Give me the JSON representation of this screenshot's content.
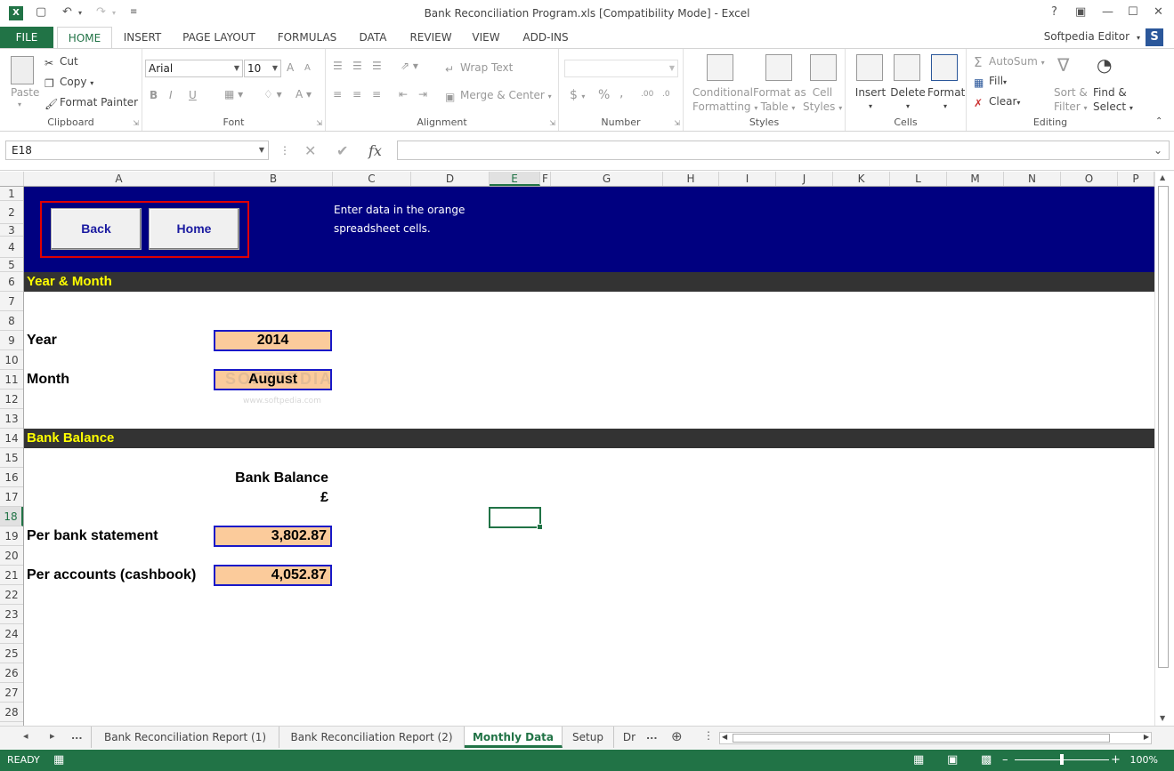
{
  "window": {
    "title": "Bank Reconciliation Program.xls  [Compatibility Mode] - Excel",
    "app_icon": "X",
    "help": "?",
    "restore_ribbon": "▣",
    "minimize": "—",
    "maximize": "☐",
    "close": "✕"
  },
  "quick_access": {
    "save": "💾",
    "undo": "↶",
    "redo": "↷",
    "customize": "⌄"
  },
  "ribbon_tabs": [
    "FILE",
    "HOME",
    "INSERT",
    "PAGE LAYOUT",
    "FORMULAS",
    "DATA",
    "REVIEW",
    "VIEW",
    "ADD-INS"
  ],
  "user": {
    "name": "Softpedia Editor",
    "initial": "S"
  },
  "ribbon": {
    "clipboard": {
      "label": "Clipboard",
      "paste": "Paste",
      "cut": "Cut",
      "copy": "Copy",
      "format_painter": "Format Painter"
    },
    "font": {
      "label": "Font",
      "name": "Arial",
      "size": "10",
      "bold": "B",
      "italic": "I",
      "underline": "U",
      "font_color": "A",
      "increase": "A",
      "decrease": "A"
    },
    "alignment": {
      "label": "Alignment",
      "wrap_text": "Wrap Text",
      "merge_center": "Merge & Center"
    },
    "number": {
      "label": "Number",
      "currency": "$",
      "percent": "%",
      "comma": ",",
      "inc_decimal": ".00",
      "dec_decimal": ".0"
    },
    "styles": {
      "label": "Styles",
      "conditional": [
        "Conditional",
        "Formatting"
      ],
      "format_table": [
        "Format as",
        "Table"
      ],
      "cell_styles": [
        "Cell",
        "Styles"
      ]
    },
    "cells": {
      "label": "Cells",
      "insert": "Insert",
      "delete": "Delete",
      "format": "Format"
    },
    "editing": {
      "label": "Editing",
      "autosum": "AutoSum",
      "fill": "Fill",
      "clear": "Clear",
      "sort_filter": [
        "Sort &",
        "Filter"
      ],
      "find_select": [
        "Find &",
        "Select"
      ]
    }
  },
  "formula_bar": {
    "name_box": "E18",
    "cancel": "✕",
    "enter": "✔",
    "fx": "fx",
    "value": ""
  },
  "columns": [
    "A",
    "B",
    "C",
    "D",
    "E",
    "F",
    "G",
    "H",
    "I",
    "J",
    "K",
    "L",
    "M",
    "N",
    "O",
    "P"
  ],
  "rows": [
    "1",
    "2",
    "3",
    "4",
    "5",
    "6",
    "7",
    "8",
    "9",
    "10",
    "11",
    "12",
    "13",
    "14",
    "15",
    "16",
    "17",
    "18",
    "19",
    "20",
    "21",
    "22",
    "23",
    "24",
    "25",
    "26",
    "27",
    "28"
  ],
  "selected": {
    "column": "E",
    "row": "18"
  },
  "sheet": {
    "back_button": "Back",
    "home_button": "Home",
    "note_line1": "Enter data in the orange",
    "note_line2": "spreadsheet cells.",
    "section_year_month": "Year & Month",
    "year_label": "Year",
    "year_value": "2014",
    "month_label": "Month",
    "month_value": "August",
    "section_bank_balance": "Bank Balance",
    "bank_balance_header": "Bank Balance",
    "currency_symbol": "£",
    "per_bank_label": "Per bank statement",
    "per_bank_value": "3,802.87",
    "per_accounts_label": "Per accounts (cashbook)",
    "per_accounts_value": "4,052.87",
    "watermark": "SOFTPEDIA",
    "watermark_url": "www.softpedia.com"
  },
  "sheet_tabs": {
    "nav_prev": "◂",
    "nav_next": "▸",
    "more": "...",
    "tabs": [
      "Bank Reconciliation Report (1)",
      "Bank Reconciliation Report (2)",
      "Monthly Data",
      "Setup",
      "Dr"
    ],
    "trailing_more": "...",
    "add": "⊕"
  },
  "status_bar": {
    "ready": "READY",
    "zoom": "100%",
    "zoom_in": "+",
    "zoom_out": "–"
  }
}
